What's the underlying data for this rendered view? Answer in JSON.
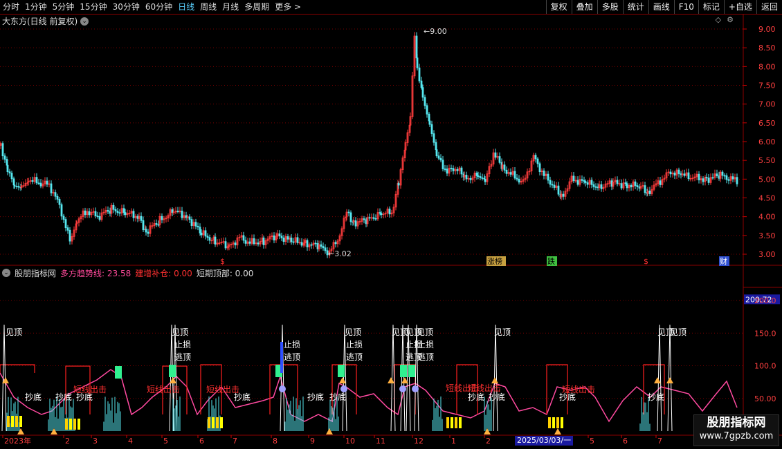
{
  "toolbar": {
    "periods": [
      "分时",
      "1分钟",
      "5分钟",
      "15分钟",
      "30分钟",
      "60分钟",
      "日线",
      "周线",
      "月线",
      "多周期",
      "更多 >"
    ],
    "active": "日线",
    "buttons": [
      "复权",
      "叠加",
      "多股",
      "统计",
      "画线",
      "F10",
      "标记",
      "+自选",
      "返回"
    ]
  },
  "main": {
    "title": "大东方(日线 前复权)",
    "price_axis": [
      "9.00",
      "8.50",
      "8.00",
      "7.50",
      "7.00",
      "6.50",
      "6.00",
      "5.50",
      "5.00",
      "4.50",
      "4.00",
      "3.50",
      "3.00"
    ],
    "high_label": "9.00",
    "low_label": "3.02",
    "events": [
      "$",
      "涨榜",
      "跌",
      "$",
      "财"
    ]
  },
  "indicator": {
    "name": "股朋指标网",
    "a_label": "多方趋势线: 23.58",
    "b_label": "建增补仓: 0.00",
    "c_label": "短期顶部: 0.00",
    "axis": [
      "200.72",
      "200.0",
      "150.0",
      "100.0",
      "50.00"
    ],
    "signals": [
      "见顶",
      "止损",
      "逃顶",
      "抄底",
      "短线出击"
    ]
  },
  "time_axis": [
    "2023年",
    "2",
    "3",
    "4",
    "5",
    "6",
    "7",
    "8",
    "9",
    "10",
    "11",
    "12",
    "1",
    "2",
    "5",
    "6",
    "7"
  ],
  "date_box": "2025/03/03/一",
  "watermark": {
    "line1": "股朋指标网",
    "line2": "www.7gpzb.com"
  },
  "colors": {
    "up": "#ff3c3c",
    "down": "#56e8f0",
    "accent": "#ff4aa0",
    "grid": "#8b0000"
  }
}
